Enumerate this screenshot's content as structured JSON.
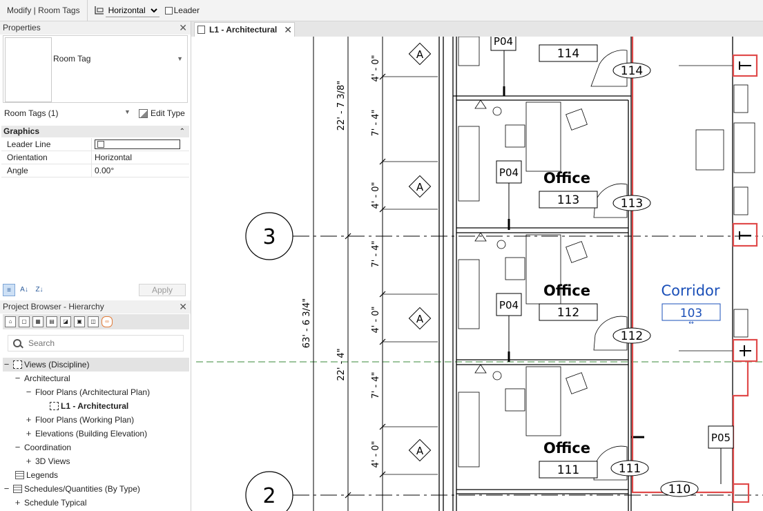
{
  "ribbon": {
    "context_label": "Modify | Room Tags",
    "orientation_value": "Horizontal",
    "leader_label": "Leader"
  },
  "properties": {
    "title": "Properties",
    "type_name": "Room Tag",
    "filter_label": "Room Tags (1)",
    "edit_type_label": "Edit Type",
    "group_label": "Graphics",
    "rows": [
      {
        "key": "Leader Line",
        "value": ""
      },
      {
        "key": "Orientation",
        "value": "Horizontal"
      },
      {
        "key": "Angle",
        "value": "0.00°"
      }
    ],
    "apply_label": "Apply"
  },
  "browser": {
    "title": "Project Browser - Hierarchy",
    "search_placeholder": "Search",
    "tree": [
      {
        "label": "Views (Discipline)"
      },
      {
        "label": "Architectural"
      },
      {
        "label": "Floor Plans (Architectural Plan)"
      },
      {
        "label": "L1 - Architectural"
      },
      {
        "label": "Floor Plans (Working Plan)"
      },
      {
        "label": "Elevations (Building Elevation)"
      },
      {
        "label": "Coordination"
      },
      {
        "label": "3D Views"
      },
      {
        "label": "Legends"
      },
      {
        "label": "Schedules/Quantities (By Type)"
      },
      {
        "label": "Schedule Typical"
      }
    ]
  },
  "view_tab": {
    "label": "L1 - Architectural"
  },
  "drawing": {
    "grid_labels": [
      "3",
      "2"
    ],
    "dimensions": [
      "4' - 0\"",
      "7' - 4\"",
      "4' - 0\"",
      "7' - 4\"",
      "4' - 0\"",
      "7' - 4\"",
      "4' - 0\"",
      "22' - 7 3/8\"",
      "63' - 6 3/4\"",
      "22' - 4\""
    ],
    "section_markers": [
      "A",
      "A",
      "A",
      "A"
    ],
    "room_names": [
      "Office",
      "Office",
      "Office",
      "Corridor"
    ],
    "room_numbers": [
      "114",
      "113",
      "112",
      "111",
      "103"
    ],
    "door_tags": [
      "114",
      "113",
      "112",
      "111",
      "110"
    ],
    "furniture_tags": [
      "P04",
      "P04",
      "P04",
      "P05"
    ],
    "colors": {
      "selection_red": "#e04a4a",
      "tag_blue": "#1a4fb8",
      "grid_dash_green": "#3a8a3a"
    }
  }
}
